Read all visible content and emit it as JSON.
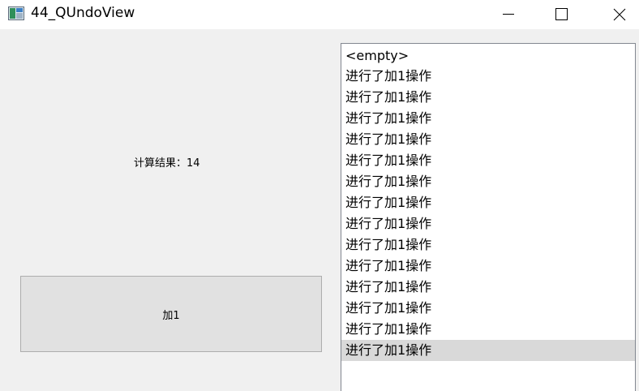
{
  "window": {
    "title": "44_QUndoView"
  },
  "calc": {
    "result_text": "计算结果：14"
  },
  "add_button": {
    "label": "加1"
  },
  "undo_view": {
    "items": [
      "<empty>",
      "进行了加1操作",
      "进行了加1操作",
      "进行了加1操作",
      "进行了加1操作",
      "进行了加1操作",
      "进行了加1操作",
      "进行了加1操作",
      "进行了加1操作",
      "进行了加1操作",
      "进行了加1操作",
      "进行了加1操作",
      "进行了加1操作",
      "进行了加1操作",
      "进行了加1操作"
    ],
    "selected_index": 14,
    "selection_color": "#d9d9d9"
  },
  "icons": {
    "app": "app-icon",
    "minimize": "minimize-icon",
    "maximize": "maximize-icon",
    "close": "close-icon"
  }
}
